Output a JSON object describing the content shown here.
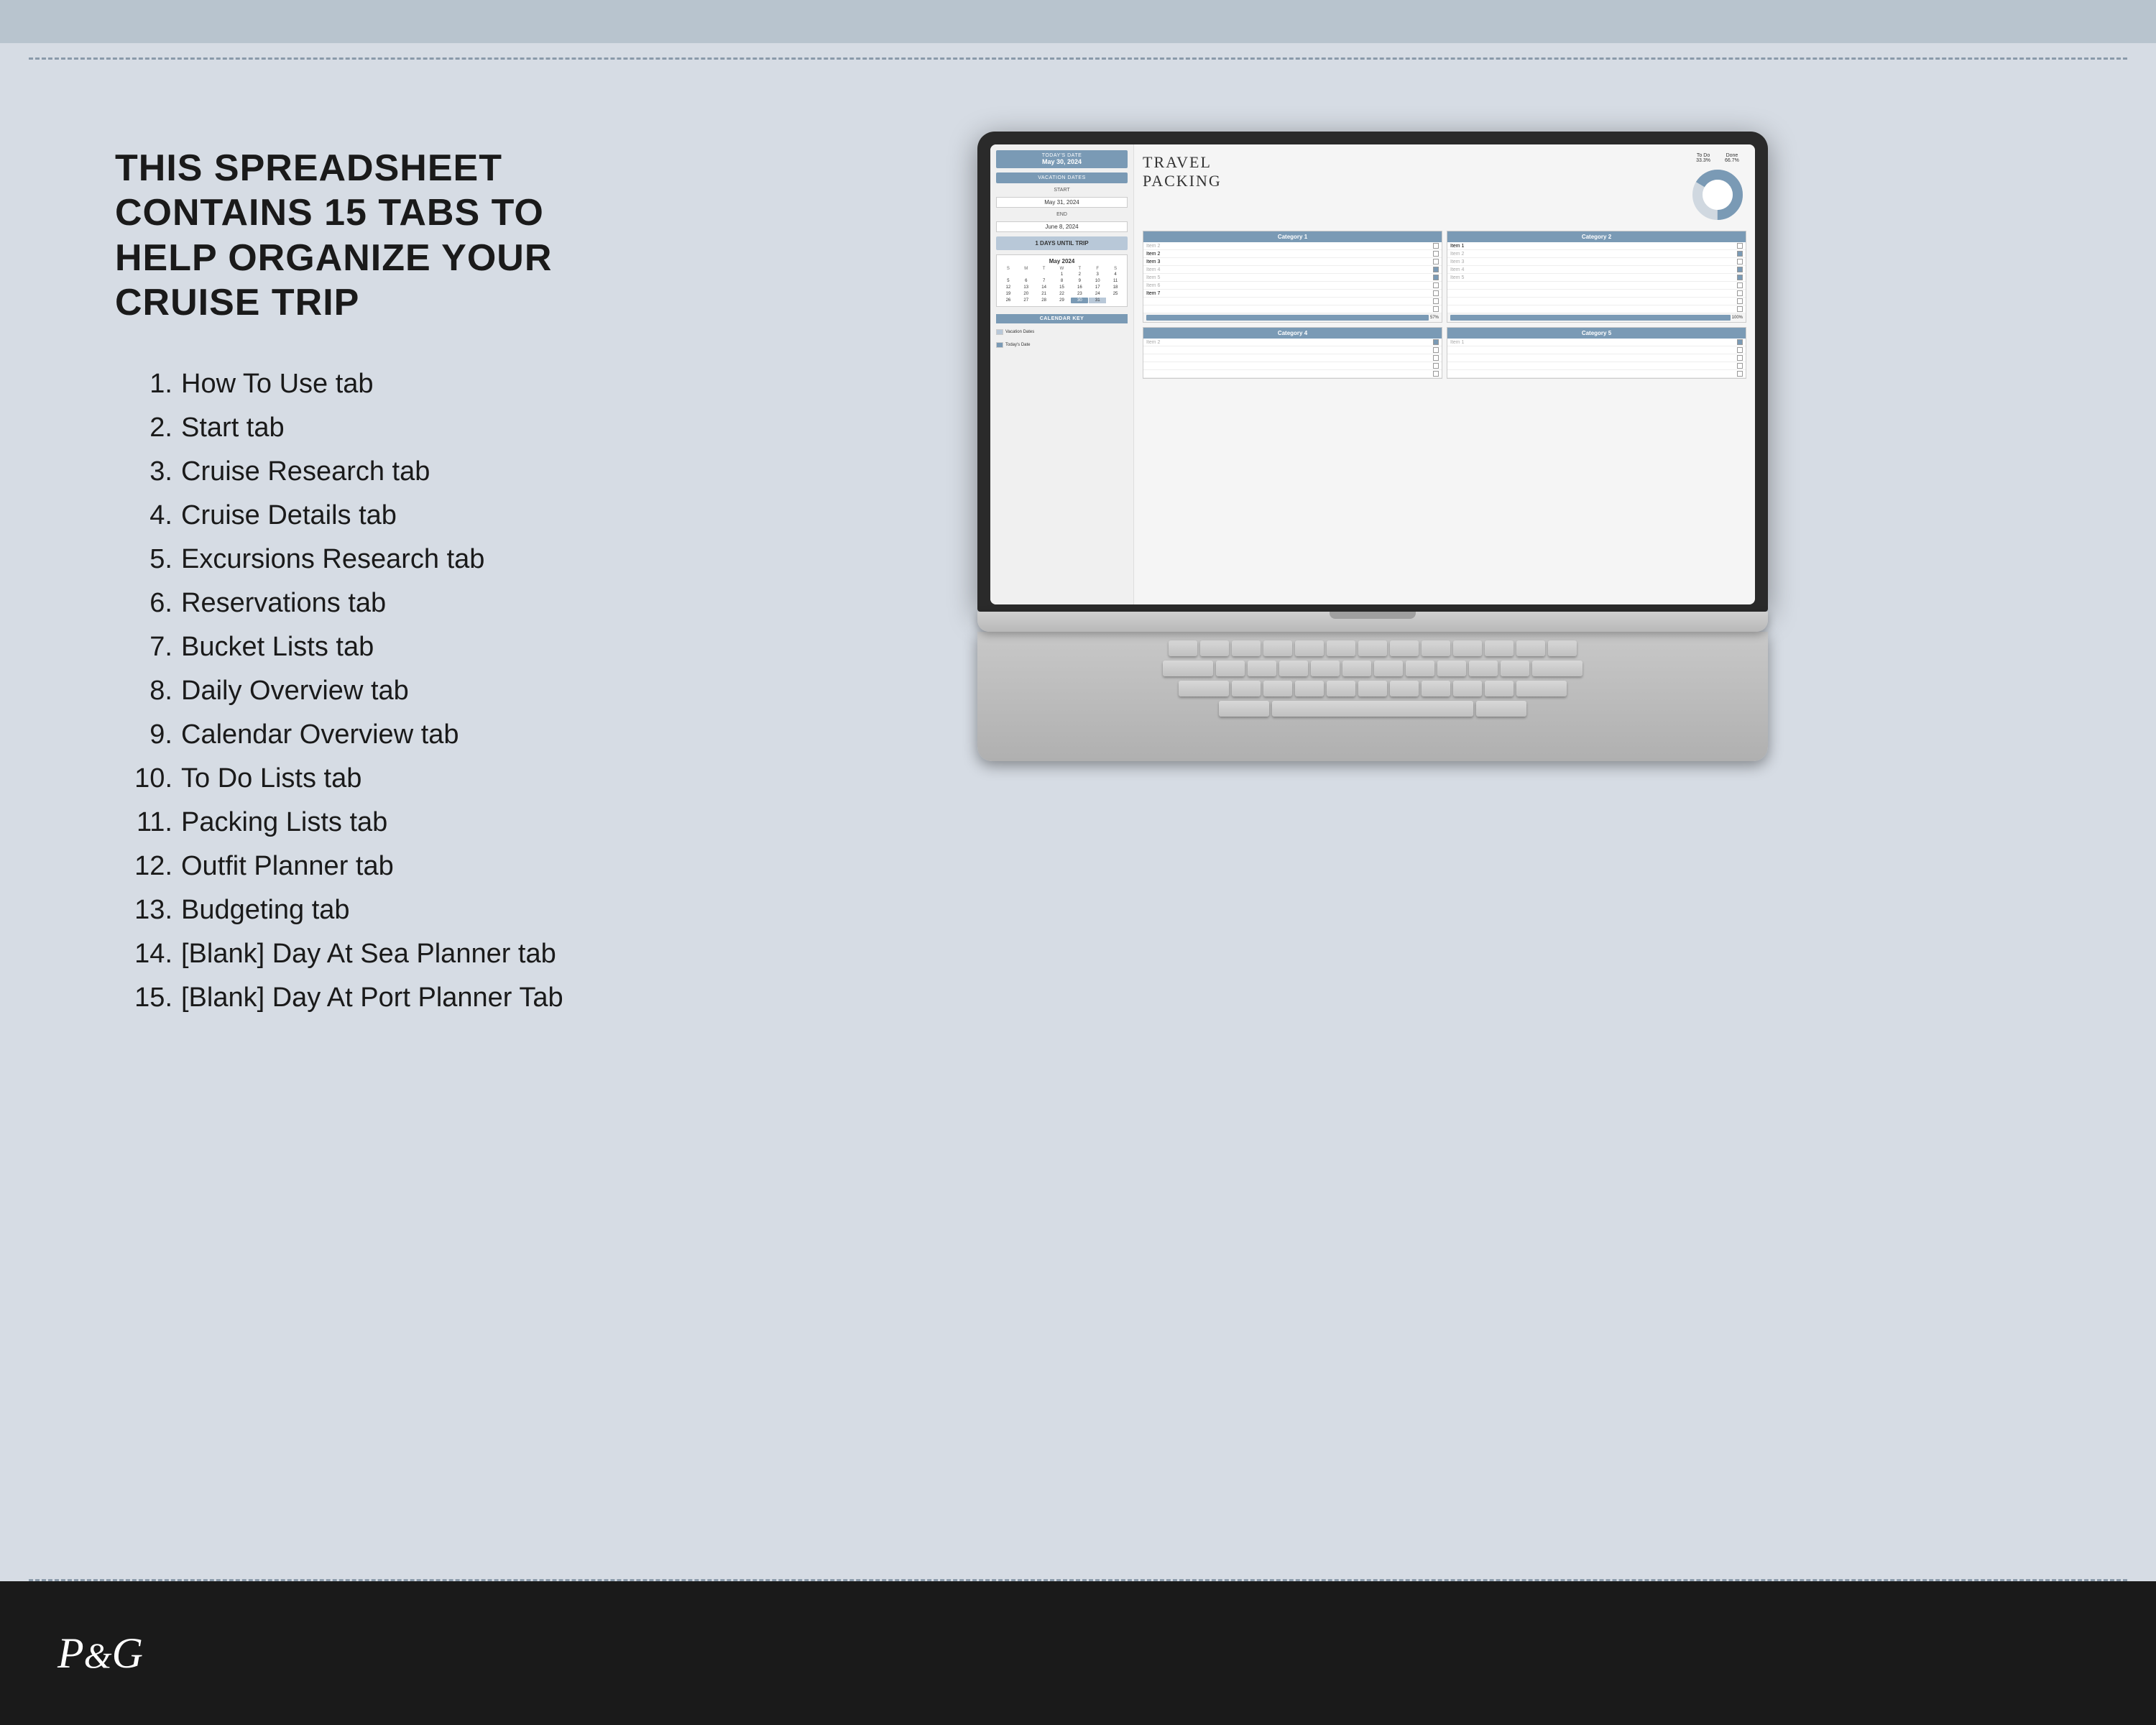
{
  "page": {
    "background_color": "#d6dce4",
    "top_strip_color": "#b8c4ce"
  },
  "headline": {
    "line1": "THIS SPREADSHEET CONTAINS 15 TABS TO",
    "line2": "HELP ORGANIZE YOUR CRUISE TRIP"
  },
  "tabs_list": [
    {
      "num": "1.",
      "label": "How To Use tab"
    },
    {
      "num": "2.",
      "label": "Start tab"
    },
    {
      "num": "3.",
      "label": "Cruise Research tab"
    },
    {
      "num": "4.",
      "label": "Cruise Details tab"
    },
    {
      "num": "5.",
      "label": "Excursions Research tab"
    },
    {
      "num": "6.",
      "label": "Reservations tab"
    },
    {
      "num": "7.",
      "label": "Bucket Lists tab"
    },
    {
      "num": "8.",
      "label": "Daily Overview tab"
    },
    {
      "num": "9.",
      "label": "Calendar Overview tab"
    },
    {
      "num": "10.",
      "label": "To Do Lists tab"
    },
    {
      "num": "11.",
      "label": "Packing Lists tab"
    },
    {
      "num": "12.",
      "label": "Outfit Planner tab"
    },
    {
      "num": "13.",
      "label": "Budgeting tab"
    },
    {
      "num": "14.",
      "label": "[Blank] Day At Sea Planner tab"
    },
    {
      "num": "15.",
      "label": "[Blank] Day At Port Planner Tab"
    }
  ],
  "spreadsheet": {
    "todays_date_label": "TODAY'S DATE",
    "todays_date_value": "May 30, 2024",
    "vacation_dates_label": "VACATION DATES",
    "start_label": "START",
    "start_value": "May 31, 2024",
    "end_label": "END",
    "end_value": "June 8, 2024",
    "days_until_trip": "1 DAYS UNTIL TRIP",
    "calendar_month": "May 2024",
    "calendar_key_label": "CALENDAR KEY",
    "calendar_key_vacation": "Vacation Dates",
    "calendar_key_today": "Today's Date",
    "title_line1": "TRAVEL",
    "title_line2": "PACKING",
    "donut_todo_label": "To Do",
    "donut_todo_pct": "33.3%",
    "donut_done_label": "Done",
    "donut_done_pct": "66.7%",
    "categories": [
      {
        "name": "Category 1",
        "items": [
          {
            "label": "Item 2",
            "dim": true,
            "checked": false
          },
          {
            "label": "Item 2",
            "dim": false,
            "checked": false
          },
          {
            "label": "Item 3",
            "dim": false,
            "checked": false
          },
          {
            "label": "Item 4",
            "dim": true,
            "checked": true
          },
          {
            "label": "Item 5",
            "dim": true,
            "checked": true
          },
          {
            "label": "Item 6",
            "dim": true,
            "checked": false
          },
          {
            "label": "Item 7",
            "dim": false,
            "checked": false
          }
        ],
        "progress": 57
      },
      {
        "name": "Category 2",
        "items": [
          {
            "label": "Item 1",
            "dim": false,
            "checked": false
          },
          {
            "label": "Item 2",
            "dim": true,
            "checked": true
          },
          {
            "label": "Item 3",
            "dim": true,
            "checked": false
          },
          {
            "label": "Item 4",
            "dim": true,
            "checked": true
          },
          {
            "label": "Item 5",
            "dim": true,
            "checked": true
          }
        ],
        "progress": 100
      },
      {
        "name": "Category 4",
        "items": [
          {
            "label": "Item 2",
            "dim": true,
            "checked": true
          }
        ],
        "progress": 0
      },
      {
        "name": "Category 5",
        "items": [
          {
            "label": "Item 1",
            "dim": true,
            "checked": true
          }
        ],
        "progress": 0
      }
    ]
  },
  "footer": {
    "logo": "P&G"
  }
}
